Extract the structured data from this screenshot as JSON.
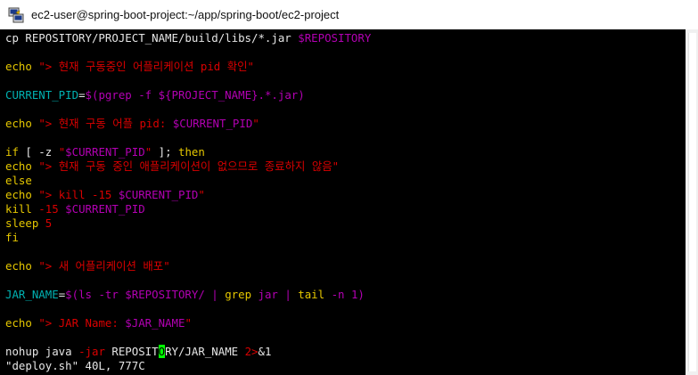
{
  "window": {
    "title": "ec2-user@spring-boot-project:~/app/spring-boot/ec2-project",
    "app_icon": "putty-icon"
  },
  "editor": {
    "status_line": "\"deploy.sh\" 40L, 777C",
    "lines": [
      [
        {
          "t": "cp REPOSITORY/PROJECT_NAME/build/libs/*.jar ",
          "c": "white"
        },
        {
          "t": "$REPOSITORY",
          "c": "magenta"
        }
      ],
      [],
      [
        {
          "t": "echo ",
          "c": "yellow"
        },
        {
          "t": "\"> 현재 구동중인 어플리케이션 pid 확인\"",
          "c": "red"
        }
      ],
      [],
      [
        {
          "t": "CURRENT_PID",
          "c": "cyan"
        },
        {
          "t": "=",
          "c": "white"
        },
        {
          "t": "$(pgrep -f ${PROJECT_NAME}.*.jar)",
          "c": "magenta"
        }
      ],
      [],
      [
        {
          "t": "echo ",
          "c": "yellow"
        },
        {
          "t": "\"> 현재 구동 어플 pid: ",
          "c": "red"
        },
        {
          "t": "$CURRENT_PID",
          "c": "magenta"
        },
        {
          "t": "\"",
          "c": "red"
        }
      ],
      [],
      [
        {
          "t": "if",
          "c": "yellow"
        },
        {
          "t": " [ -z ",
          "c": "white"
        },
        {
          "t": "\"",
          "c": "red"
        },
        {
          "t": "$CURRENT_PID",
          "c": "magenta"
        },
        {
          "t": "\"",
          "c": "red"
        },
        {
          "t": " ]; ",
          "c": "white"
        },
        {
          "t": "then",
          "c": "yellow"
        }
      ],
      [
        {
          "t": "echo ",
          "c": "yellow"
        },
        {
          "t": "\"> 현재 구동 중인 애플리케이션이 없으므로 종료하지 않음\"",
          "c": "red"
        }
      ],
      [
        {
          "t": "else",
          "c": "yellow"
        }
      ],
      [
        {
          "t": "echo ",
          "c": "yellow"
        },
        {
          "t": "\"> kill -15 ",
          "c": "red"
        },
        {
          "t": "$CURRENT_PID",
          "c": "magenta"
        },
        {
          "t": "\"",
          "c": "red"
        }
      ],
      [
        {
          "t": "kill",
          "c": "yellow"
        },
        {
          "t": " -15 ",
          "c": "red"
        },
        {
          "t": "$CURRENT_PID",
          "c": "magenta"
        }
      ],
      [
        {
          "t": "sleep",
          "c": "yellow"
        },
        {
          "t": " 5",
          "c": "red"
        }
      ],
      [
        {
          "t": "fi",
          "c": "yellow"
        }
      ],
      [],
      [
        {
          "t": "echo ",
          "c": "yellow"
        },
        {
          "t": "\"> 새 어플리케이션 배포\"",
          "c": "red"
        }
      ],
      [],
      [
        {
          "t": "JAR_NAME",
          "c": "cyan"
        },
        {
          "t": "=",
          "c": "white"
        },
        {
          "t": "$(ls -tr ",
          "c": "magenta"
        },
        {
          "t": "$REPOSITORY",
          "c": "magenta"
        },
        {
          "t": "/ | ",
          "c": "magenta"
        },
        {
          "t": "grep",
          "c": "yellow"
        },
        {
          "t": " jar | ",
          "c": "magenta"
        },
        {
          "t": "tail",
          "c": "yellow"
        },
        {
          "t": " -n 1)",
          "c": "magenta"
        }
      ],
      [],
      [
        {
          "t": "echo ",
          "c": "yellow"
        },
        {
          "t": "\"> JAR Name: ",
          "c": "red"
        },
        {
          "t": "$JAR_NAME",
          "c": "magenta"
        },
        {
          "t": "\"",
          "c": "red"
        }
      ],
      [],
      [
        {
          "t": "nohup java ",
          "c": "white"
        },
        {
          "t": "-jar",
          "c": "red"
        },
        {
          "t": " REPOSIT",
          "c": "white"
        },
        {
          "t": "O",
          "c": "cursor"
        },
        {
          "t": "RY/JAR_NAME ",
          "c": "white"
        },
        {
          "t": "2>",
          "c": "red"
        },
        {
          "t": "&1",
          "c": "white"
        }
      ]
    ]
  },
  "colors": {
    "background": "#000000",
    "white": "#e6e6e6",
    "yellow": "#e5c700",
    "red": "#d90000",
    "magenta": "#b300b3",
    "cyan": "#00b2b2",
    "cursor": "#00ff00"
  }
}
